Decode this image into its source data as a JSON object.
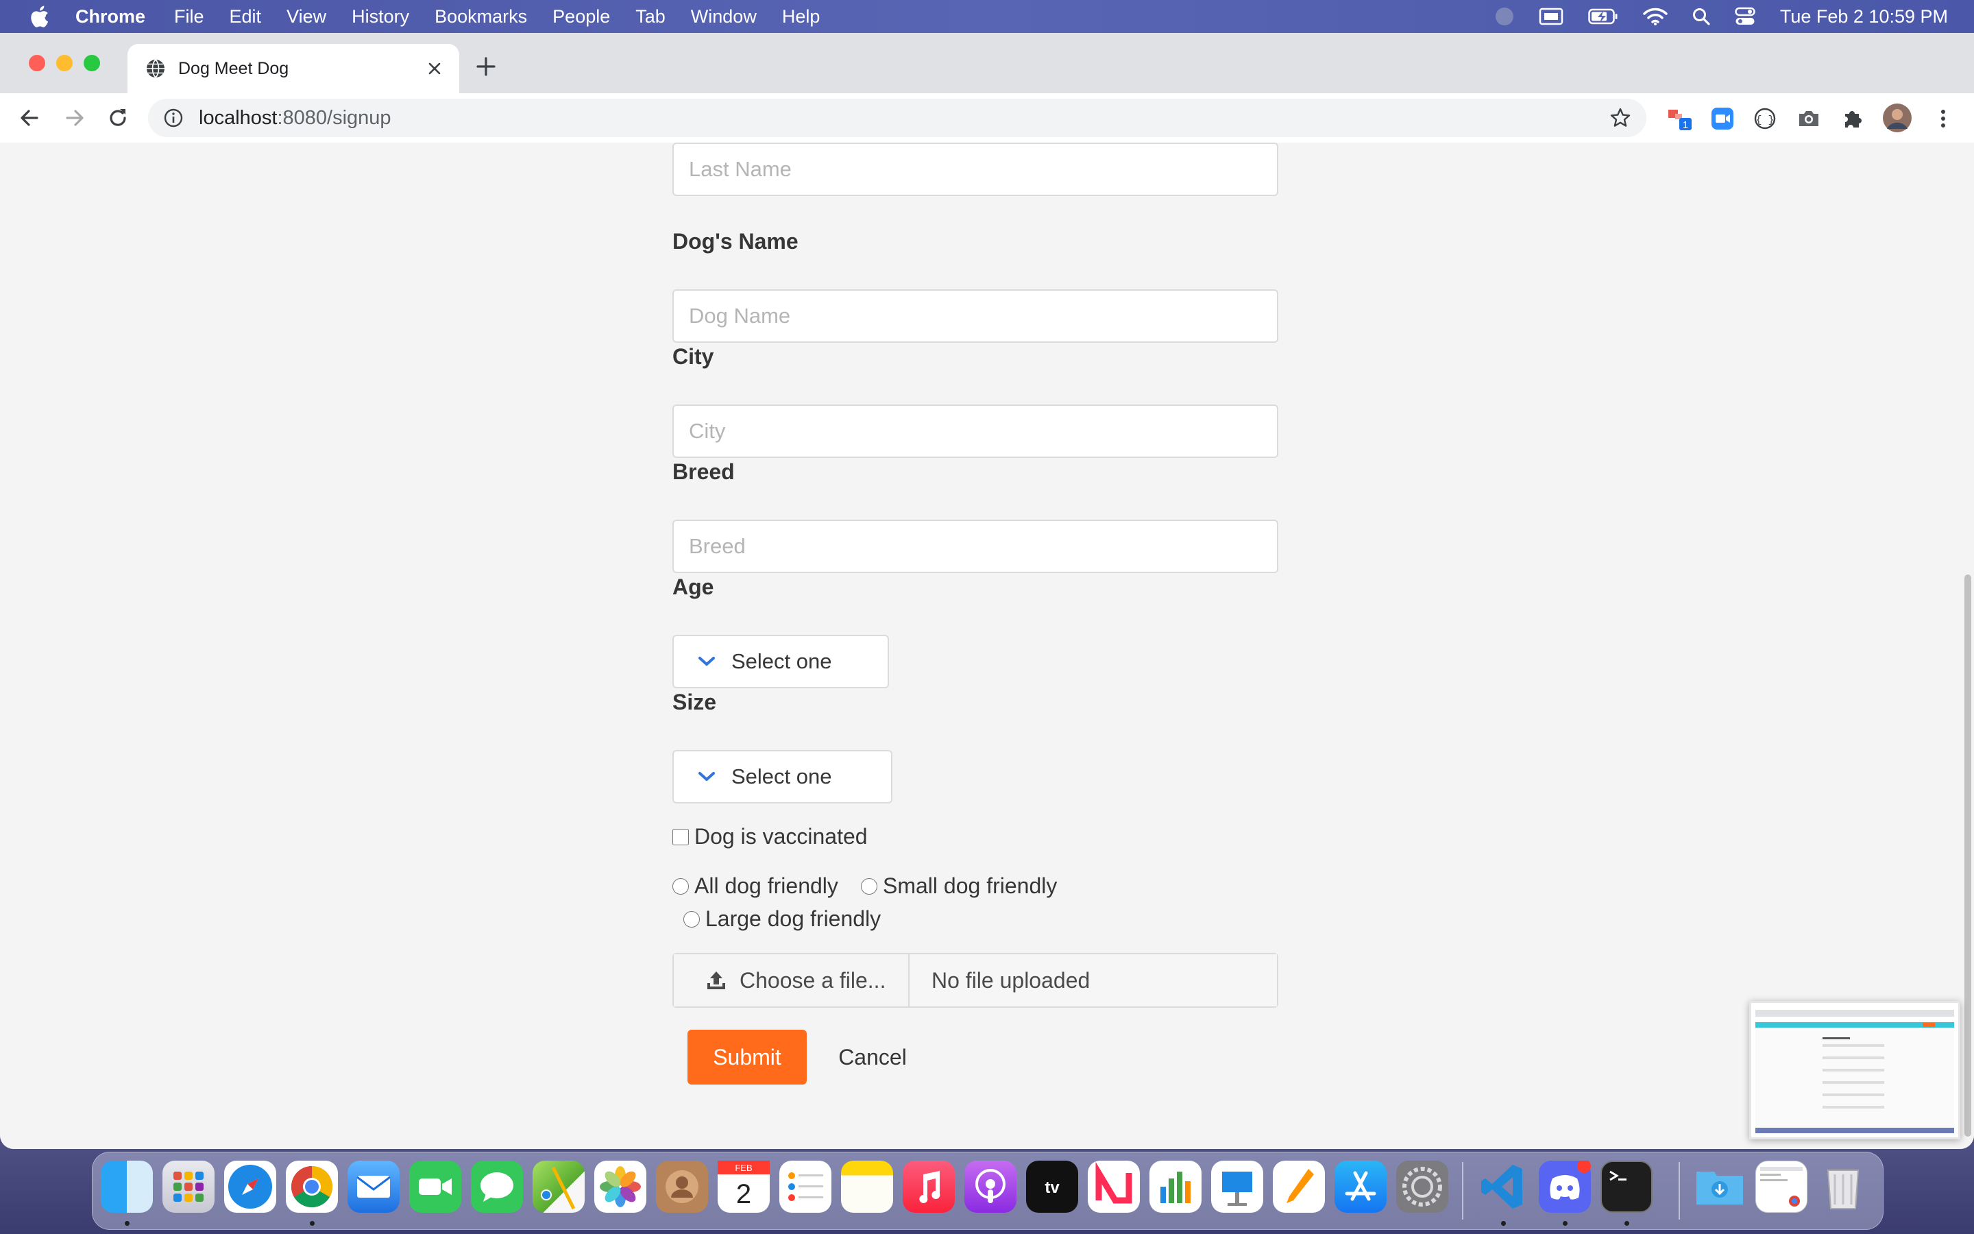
{
  "menubar": {
    "app_name": "Chrome",
    "menus": [
      "File",
      "Edit",
      "View",
      "History",
      "Bookmarks",
      "People",
      "Tab",
      "Window",
      "Help"
    ],
    "clock": "Tue Feb 2  10:59 PM",
    "status_icons": [
      "siri-icon",
      "display-icon",
      "battery-icon",
      "wifi-icon",
      "spotlight-icon",
      "control-center-icon"
    ]
  },
  "browser": {
    "tab_title": "Dog Meet Dog",
    "url_host": "localhost",
    "url_path": ":8080/signup",
    "extension_badge": "1"
  },
  "form": {
    "last_name_placeholder": "Last Name",
    "dog_name_label": "Dog's Name",
    "dog_name_placeholder": "Dog Name",
    "city_label": "City",
    "city_placeholder": "City",
    "breed_label": "Breed",
    "breed_placeholder": "Breed",
    "age_label": "Age",
    "age_value": "Select one",
    "size_label": "Size",
    "size_value": "Select one",
    "vaccinated_label": "Dog is vaccinated",
    "vaccinated_checked": false,
    "friendliness_options": [
      "All dog friendly",
      "Small dog friendly",
      "Large dog friendly"
    ],
    "file_cta": "Choose a file...",
    "file_name": "No file uploaded",
    "submit_label": "Submit",
    "cancel_label": "Cancel"
  },
  "colors": {
    "accent": "#ff6b1a",
    "page_bg": "#f4f4f4",
    "label_text": "#363636"
  },
  "dock": {
    "calendar_month": "FEB",
    "calendar_day": "2",
    "apps": [
      "Finder",
      "Launchpad",
      "Safari",
      "Chrome",
      "Mail",
      "FaceTime",
      "Messages",
      "Maps",
      "Photos",
      "Contacts",
      "Calendar",
      "Reminders",
      "Notes",
      "Music",
      "Podcasts",
      "TV",
      "News",
      "Numbers",
      "Keynote",
      "Pages",
      "App Store",
      "System Preferences",
      "Visual Studio Code",
      "Discord",
      "Terminal",
      "Downloads",
      "Documents",
      "Trash"
    ]
  }
}
